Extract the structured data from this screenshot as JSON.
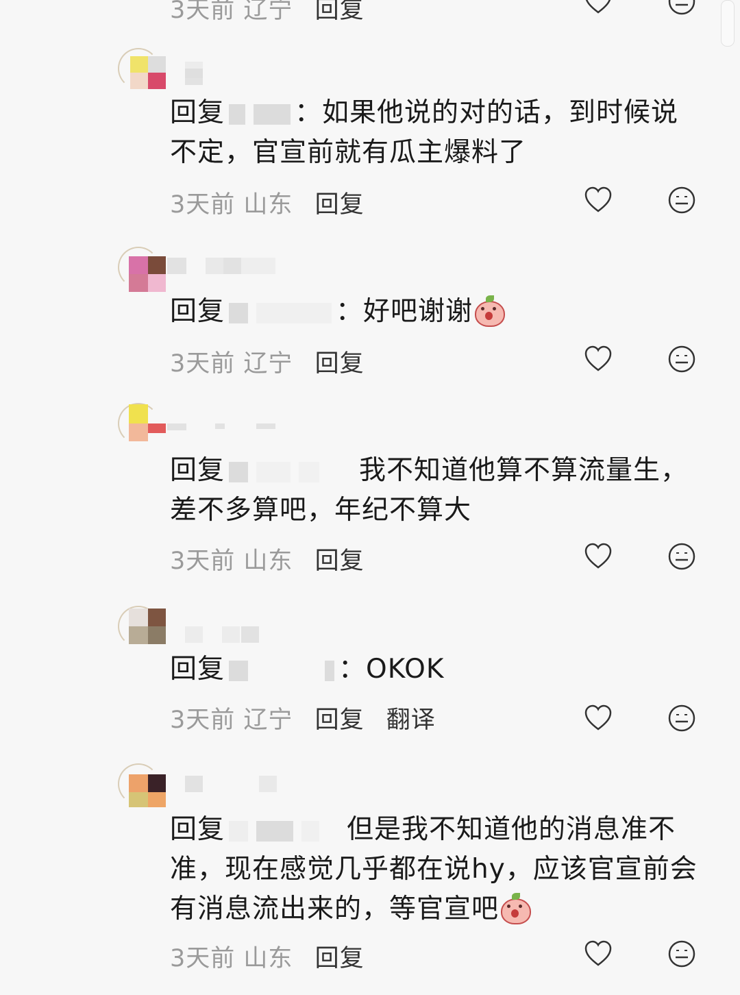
{
  "scrollbar": {},
  "top_partial": {
    "time": "3天前",
    "location": "辽宁",
    "reply_label": "回复"
  },
  "comments": [
    {
      "prefix": "回复",
      "content_before": "：如果他说的对的话，到时候说不定，官宣前就有瓜主爆料了",
      "time": "3天前",
      "location": "山东",
      "reply_label": "回复"
    },
    {
      "prefix": "回复",
      "content_before": "：好吧谢谢",
      "time": "3天前",
      "location": "辽宁",
      "reply_label": "回复",
      "emoji": "peach-face-emoji"
    },
    {
      "prefix": "回复",
      "content_before": "我不知道他算不算流量生，差不多算吧，年纪不算大",
      "time": "3天前",
      "location": "山东",
      "reply_label": "回复"
    },
    {
      "prefix": "回复",
      "content_before": "：OKOK",
      "time": "3天前",
      "location": "辽宁",
      "reply_label": "回复",
      "translate_label": "翻译"
    },
    {
      "prefix": "回复",
      "content_before": "但是我不知道他的消息准不准，现在感觉几乎都在说hy，应该官宣前会有消息流出来的，等官宣吧",
      "time": "3天前",
      "location": "山东",
      "reply_label": "回复",
      "emoji": "peach-face-emoji"
    }
  ],
  "icons": {
    "like": "heart-icon",
    "dislike": "neutral-face-icon"
  },
  "colors": {
    "background": "#f7f7f7",
    "text": "#1a1a1a",
    "meta": "#9a9a9a"
  }
}
